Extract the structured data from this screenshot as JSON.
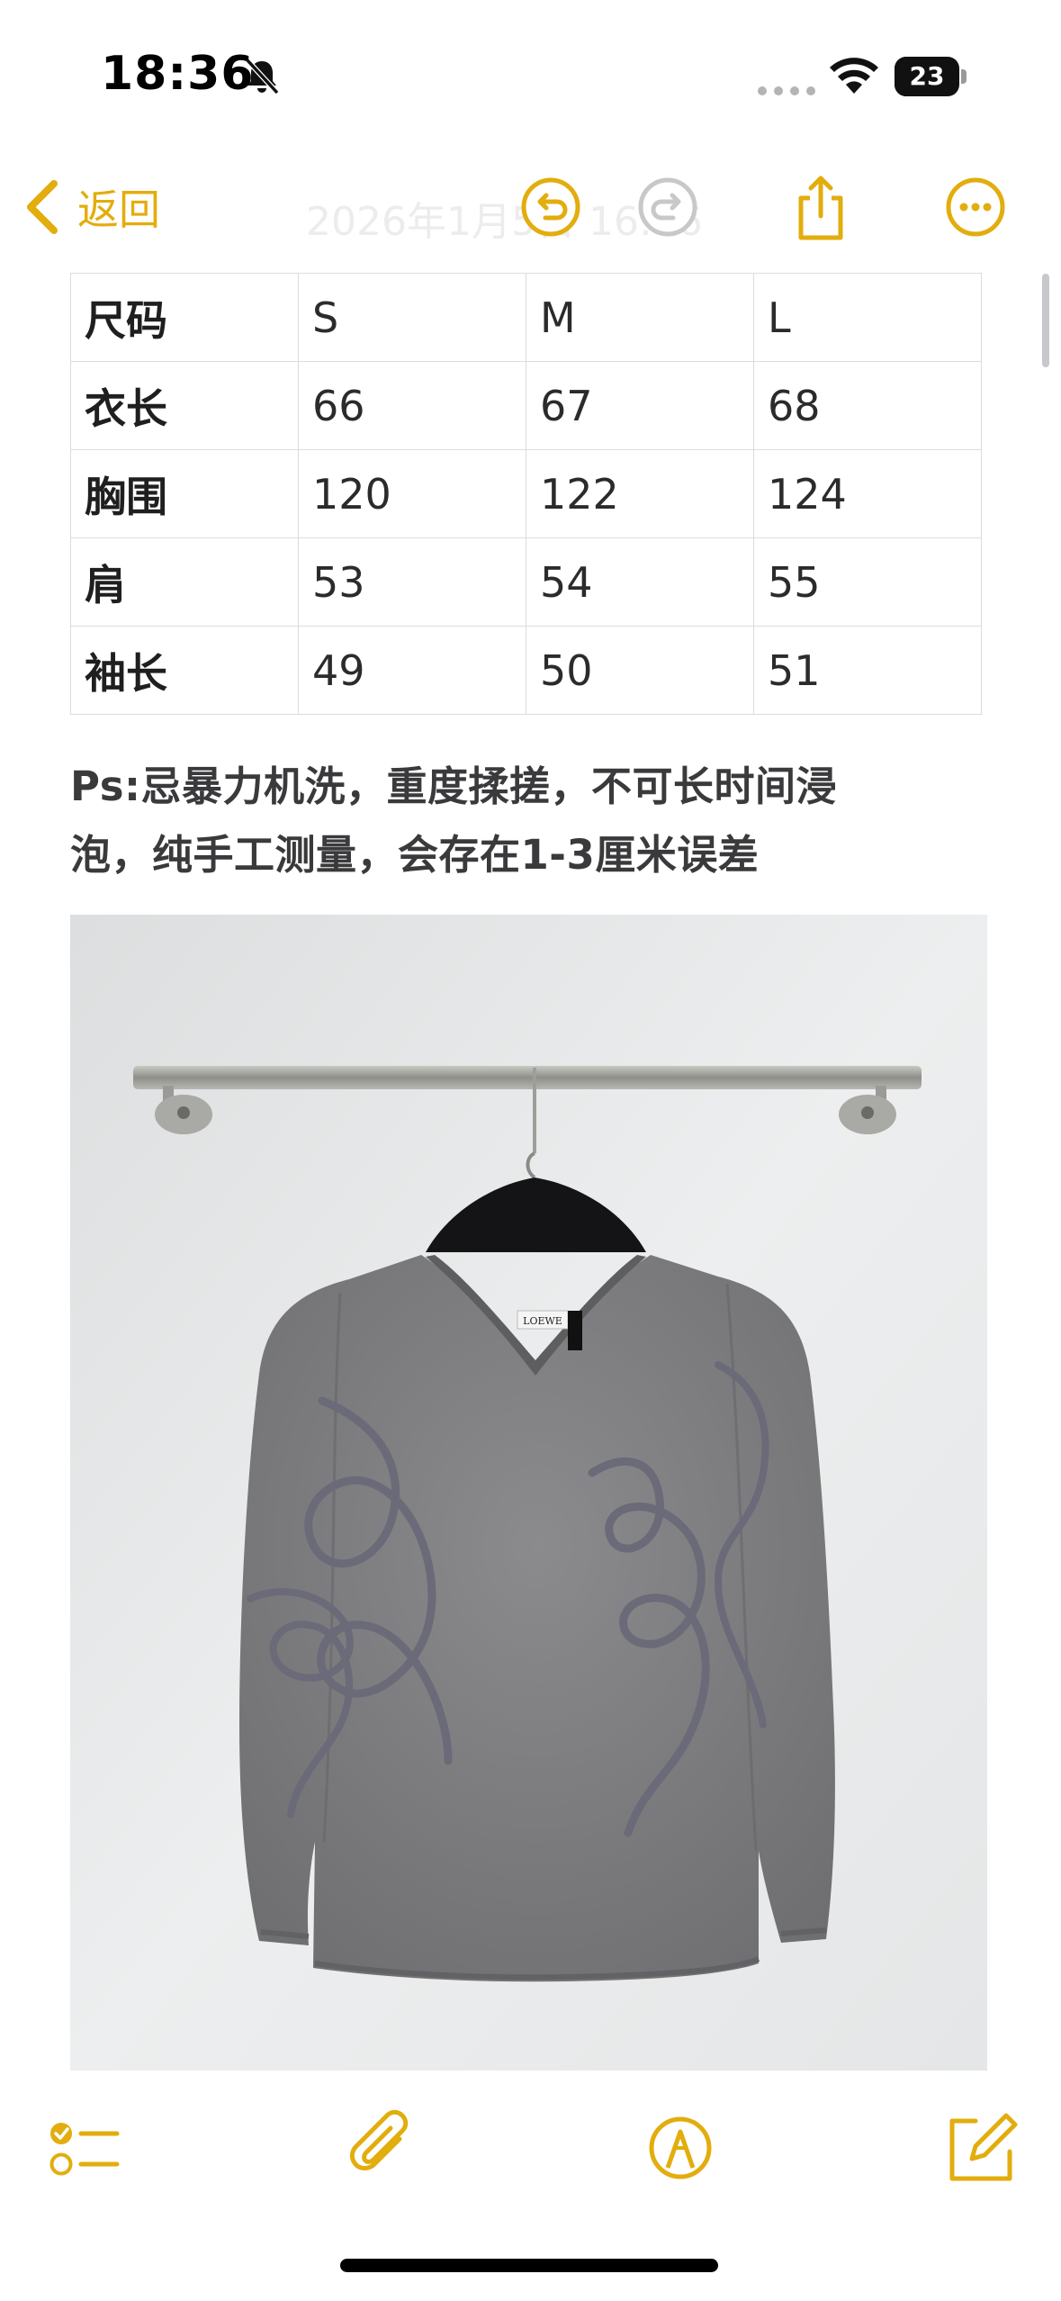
{
  "status_bar": {
    "time": "18:36",
    "battery": "23",
    "battery_level": 0.23,
    "icons": [
      "bell-slash-icon",
      "signal-dots-icon",
      "wifi-icon",
      "battery-icon"
    ]
  },
  "nav": {
    "back_label": "返回",
    "title": "2026年1月5日 16:36",
    "icons": [
      "chevron-left-icon",
      "undo-icon",
      "redo-icon",
      "share-icon",
      "more-icon"
    ]
  },
  "size_table": {
    "rows": [
      [
        "尺码",
        "S",
        "M",
        "L"
      ],
      [
        "衣长",
        "66",
        "67",
        "68"
      ],
      [
        "胸围",
        "120",
        "122",
        "124"
      ],
      [
        "肩",
        "53",
        "54",
        "55"
      ],
      [
        "袖长",
        "49",
        "50",
        "51"
      ]
    ]
  },
  "note": {
    "line1": "Ps:忌暴力机洗，重度揉搓，不可长时间浸",
    "line2": "泡，纯手工测量，会存在1-3厘米误差"
  },
  "photo": {
    "label_text": "LOEWE"
  },
  "toolbar": {
    "icons": [
      "checklist-icon",
      "paperclip-icon",
      "markup-icon",
      "compose-icon"
    ]
  },
  "colors": {
    "accent": "#e2ad0d",
    "disabled": "#c8c8c8",
    "sweater": "#7f7f82"
  }
}
